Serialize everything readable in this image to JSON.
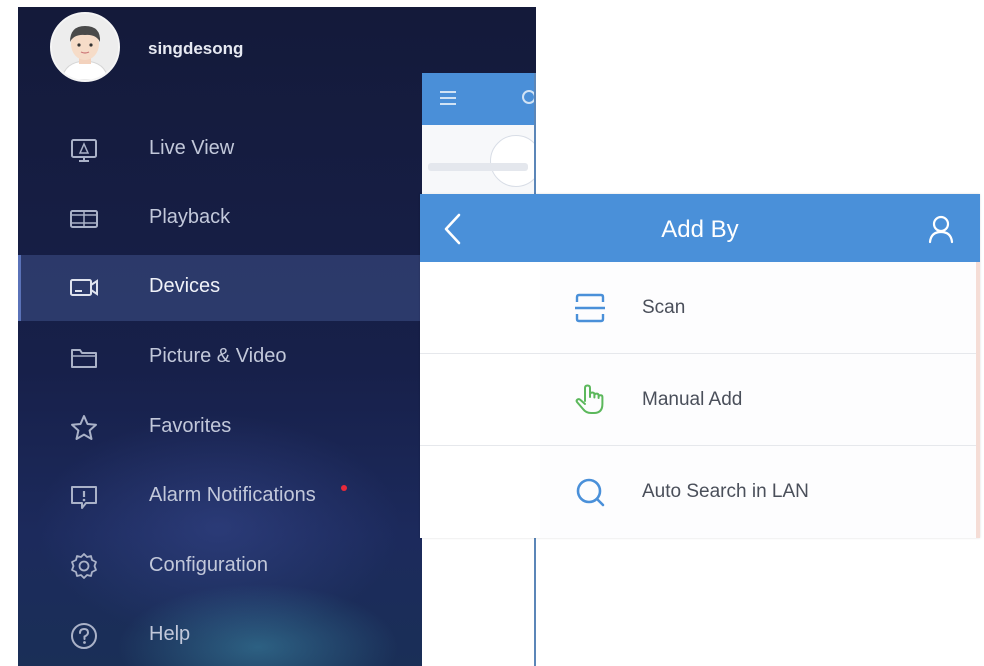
{
  "profile": {
    "username": "singdesong"
  },
  "nav": {
    "items": [
      {
        "id": "live-view",
        "label": "Live View",
        "icon": "monitor-icon",
        "active": false
      },
      {
        "id": "playback",
        "label": "Playback",
        "icon": "film-strip-icon",
        "active": false
      },
      {
        "id": "devices",
        "label": "Devices",
        "icon": "camera-icon",
        "active": true
      },
      {
        "id": "picture-video",
        "label": "Picture & Video",
        "icon": "folder-icon",
        "active": false
      },
      {
        "id": "favorites",
        "label": "Favorites",
        "icon": "star-icon",
        "active": false
      },
      {
        "id": "alarm-notifications",
        "label": "Alarm Notifications",
        "icon": "alert-message-icon",
        "active": false,
        "badge": true
      },
      {
        "id": "configuration",
        "label": "Configuration",
        "icon": "gear-icon",
        "active": false
      },
      {
        "id": "help",
        "label": "Help",
        "icon": "help-circle-icon",
        "active": false
      }
    ]
  },
  "add_by": {
    "title": "Add By",
    "back_icon": "chevron-left-icon",
    "user_icon": "user-icon",
    "options": [
      {
        "id": "scan",
        "label": "Scan",
        "icon": "scan-frame-icon",
        "color": "#4a90d9"
      },
      {
        "id": "manual-add",
        "label": "Manual Add",
        "icon": "hand-pointer-icon",
        "color": "#5cb85c"
      },
      {
        "id": "auto-search",
        "label": "Auto Search in LAN",
        "icon": "search-lan-icon",
        "color": "#4a90d9"
      }
    ]
  },
  "colors": {
    "drawer_bg": "#17204a",
    "header_blue": "#4a90d9",
    "badge_red": "#e8293a",
    "nav_text": "#c2c8da"
  }
}
